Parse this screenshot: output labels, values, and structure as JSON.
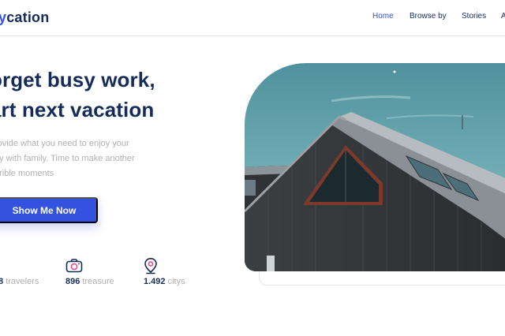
{
  "brand": {
    "logo_accent": "y",
    "logo_rest": "cation",
    "accent_color": "#3252df",
    "primary_color": "#152c5b"
  },
  "nav": {
    "home": "Home",
    "browse": "Browse by",
    "stories": "Stories",
    "cut": "A"
  },
  "hero": {
    "headline_1": "orget busy work,",
    "headline_2": "art  next vacation",
    "desc_1": "rovide what you need to enjoy your",
    "desc_2": "ay with family. Time to make another",
    "desc_3": "orible moments",
    "cta_label": "Show Me Now",
    "image_alt": "Modern dark timber house with gable roof under blue sky"
  },
  "stats": [
    {
      "icon": "travelers-icon",
      "value": "8",
      "label": "travelers"
    },
    {
      "icon": "camera-icon",
      "value": "896",
      "label": "treasure"
    },
    {
      "icon": "location-pin-icon",
      "value": "1.492",
      "label": "citys"
    }
  ]
}
